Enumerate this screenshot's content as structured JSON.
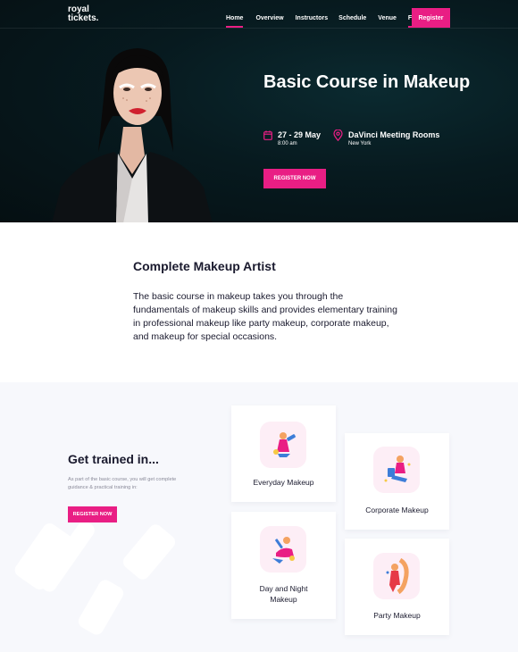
{
  "brand": {
    "line1": "royal",
    "line2": "tickets."
  },
  "nav": {
    "items": [
      "Home",
      "Overview",
      "Instructors",
      "Schedule",
      "Venue",
      "FAQ"
    ],
    "active": [
      "Home",
      "FAQ"
    ],
    "register_label": "Register"
  },
  "hero": {
    "title": "Basic Course in Makeup",
    "date": "27 - 29 May",
    "time": "8:00 am",
    "venue": "DaVinci Meeting Rooms",
    "city": "New York",
    "cta_label": "REGISTER NOW"
  },
  "about": {
    "title": "Complete Makeup Artist",
    "text": "The basic course in makeup takes you through the fundamentals of makeup skills and provides elementary training in professional makeup like party makeup, corporate makeup, and makeup for special occasions."
  },
  "trained": {
    "title": "Get trained in...",
    "subtitle": "As part of the basic course, you will get complete guidance & practical training in:",
    "cta_label": "REGISTER NOW",
    "cards": [
      {
        "label": "Everyday Makeup",
        "icon": "everyday-makeup-illustration-icon"
      },
      {
        "label": "Corporate Makeup",
        "icon": "corporate-makeup-illustration-icon"
      },
      {
        "label": "Day and Night Makeup",
        "icon": "day-night-makeup-illustration-icon"
      },
      {
        "label": "Party Makeup",
        "icon": "party-makeup-illustration-icon"
      }
    ]
  },
  "colors": {
    "accent": "#e91e84",
    "hero_bg": "#061a1f",
    "section_bg": "#f7f8fc",
    "text": "#1a1a2e"
  }
}
